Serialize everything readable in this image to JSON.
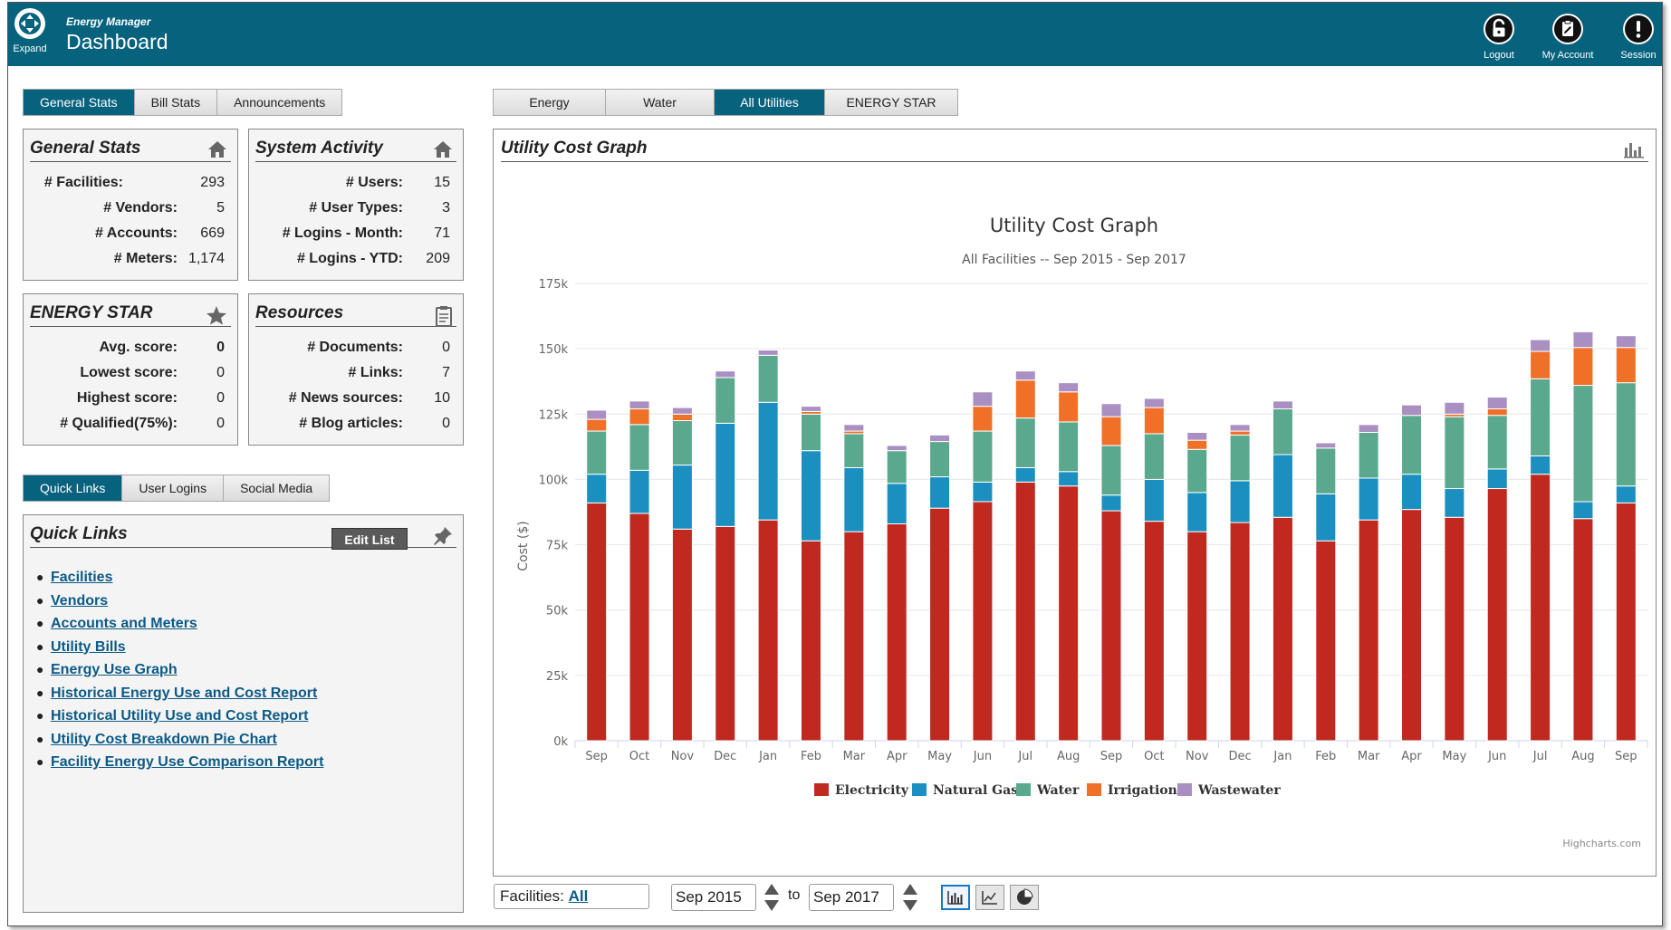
{
  "header": {
    "expand_label": "Expand",
    "app_subtitle": "Energy Manager",
    "page_title": "Dashboard",
    "buttons": [
      "Logout",
      "My Account",
      "Session"
    ]
  },
  "left_tabs": [
    "General Stats",
    "Bill Stats",
    "Announcements"
  ],
  "general_stats": {
    "title": "General Stats",
    "rows": [
      {
        "k": "# Facilities:",
        "v": "293"
      },
      {
        "k": "# Vendors:",
        "v": "5"
      },
      {
        "k": "# Accounts:",
        "v": "669"
      },
      {
        "k": "# Meters:",
        "v": "1,174"
      }
    ]
  },
  "system_activity": {
    "title": "System Activity",
    "rows": [
      {
        "k": "# Users:",
        "v": "15"
      },
      {
        "k": "# User Types:",
        "v": "3"
      },
      {
        "k": "# Logins - Month:",
        "v": "71"
      },
      {
        "k": "# Logins - YTD:",
        "v": "209"
      }
    ]
  },
  "energy_star": {
    "title": "ENERGY STAR",
    "rows": [
      {
        "k": "Avg. score:",
        "v": "0"
      },
      {
        "k": "Lowest score:",
        "v": "0"
      },
      {
        "k": "Highest score:",
        "v": "0"
      },
      {
        "k": "# Qualified(75%):",
        "v": "0"
      }
    ]
  },
  "resources": {
    "title": "Resources",
    "rows": [
      {
        "k": "# Documents:",
        "v": "0"
      },
      {
        "k": "# Links:",
        "v": "7"
      },
      {
        "k": "# News sources:",
        "v": "10"
      },
      {
        "k": "# Blog articles:",
        "v": "0"
      }
    ]
  },
  "lower_tabs": [
    "Quick Links",
    "User Logins",
    "Social Media"
  ],
  "quick_links": {
    "title": "Quick Links",
    "edit_label": "Edit List",
    "items": [
      "Facilities",
      "Vendors",
      "Accounts and Meters",
      "Utility Bills",
      "Energy Use Graph",
      "Historical Energy Use and Cost Report",
      "Historical Utility Use and Cost Report",
      "Utility Cost Breakdown Pie Chart",
      "Facility Energy Use Comparison Report"
    ]
  },
  "right_tabs": [
    "Energy",
    "Water",
    "All Utilities",
    "ENERGY STAR"
  ],
  "chart_panel_title": "Utility Cost Graph",
  "credit": "Highcharts.com",
  "controls": {
    "facilities_label": "Facilities:",
    "facilities_value": "All",
    "from_date": "Sep 2015",
    "to_label": "to",
    "to_date": "Sep 2017"
  },
  "colors": {
    "header_bg": "#07627e",
    "Electricity": "#c0291f",
    "Natural Gas": "#1a8fc0",
    "Water": "#5aa88d",
    "Irrigation": "#f07028",
    "Wastewater": "#a98fc2"
  },
  "chart_data": {
    "type": "bar",
    "stacked": true,
    "title": "Utility Cost Graph",
    "subtitle": "All Facilities -- Sep 2015 - Sep 2017",
    "ylabel": "Cost ($)",
    "ylim": [
      0,
      175000
    ],
    "yticks": [
      "0k",
      "25k",
      "50k",
      "75k",
      "100k",
      "125k",
      "150k",
      "175k"
    ],
    "grid": true,
    "legend_position": "bottom-center",
    "categories": [
      "Sep",
      "Oct",
      "Nov",
      "Dec",
      "Jan",
      "Feb",
      "Mar",
      "Apr",
      "May",
      "Jun",
      "Jul",
      "Aug",
      "Sep",
      "Oct",
      "Nov",
      "Dec",
      "Jan",
      "Feb",
      "Mar",
      "Apr",
      "May",
      "Jun",
      "Jul",
      "Aug",
      "Sep"
    ],
    "series": [
      {
        "name": "Electricity",
        "values": [
          91000,
          87000,
          81000,
          82000,
          84500,
          76500,
          80000,
          83000,
          89000,
          91500,
          99000,
          97500,
          88000,
          84000,
          80000,
          83500,
          85500,
          76500,
          84500,
          88500,
          85500,
          96500,
          102000,
          85000,
          91000
        ]
      },
      {
        "name": "Natural Gas",
        "values": [
          11000,
          16500,
          24500,
          39500,
          45000,
          34500,
          24500,
          15500,
          12000,
          7500,
          5500,
          5500,
          6000,
          16000,
          15000,
          16000,
          24000,
          18000,
          16000,
          13500,
          11000,
          7500,
          7000,
          6500,
          6500
        ]
      },
      {
        "name": "Water",
        "values": [
          16500,
          17500,
          17000,
          17500,
          18000,
          14000,
          13000,
          12500,
          13500,
          19500,
          19000,
          19000,
          19000,
          17500,
          16500,
          17500,
          17500,
          17500,
          17500,
          22500,
          27500,
          20500,
          29500,
          44500,
          39500
        ]
      },
      {
        "name": "Irrigation",
        "values": [
          4500,
          6000,
          2500,
          0,
          0,
          1000,
          1000,
          0,
          0,
          9500,
          14500,
          11500,
          11000,
          10000,
          3500,
          1500,
          0,
          0,
          0,
          0,
          1000,
          2500,
          10500,
          14500,
          13500
        ]
      },
      {
        "name": "Wastewater",
        "values": [
          3500,
          3000,
          2500,
          2500,
          2000,
          2000,
          2500,
          2000,
          2500,
          5500,
          3500,
          3500,
          5000,
          3500,
          3000,
          2500,
          3000,
          2000,
          3000,
          4000,
          4500,
          4500,
          4500,
          6000,
          4500
        ]
      }
    ]
  }
}
